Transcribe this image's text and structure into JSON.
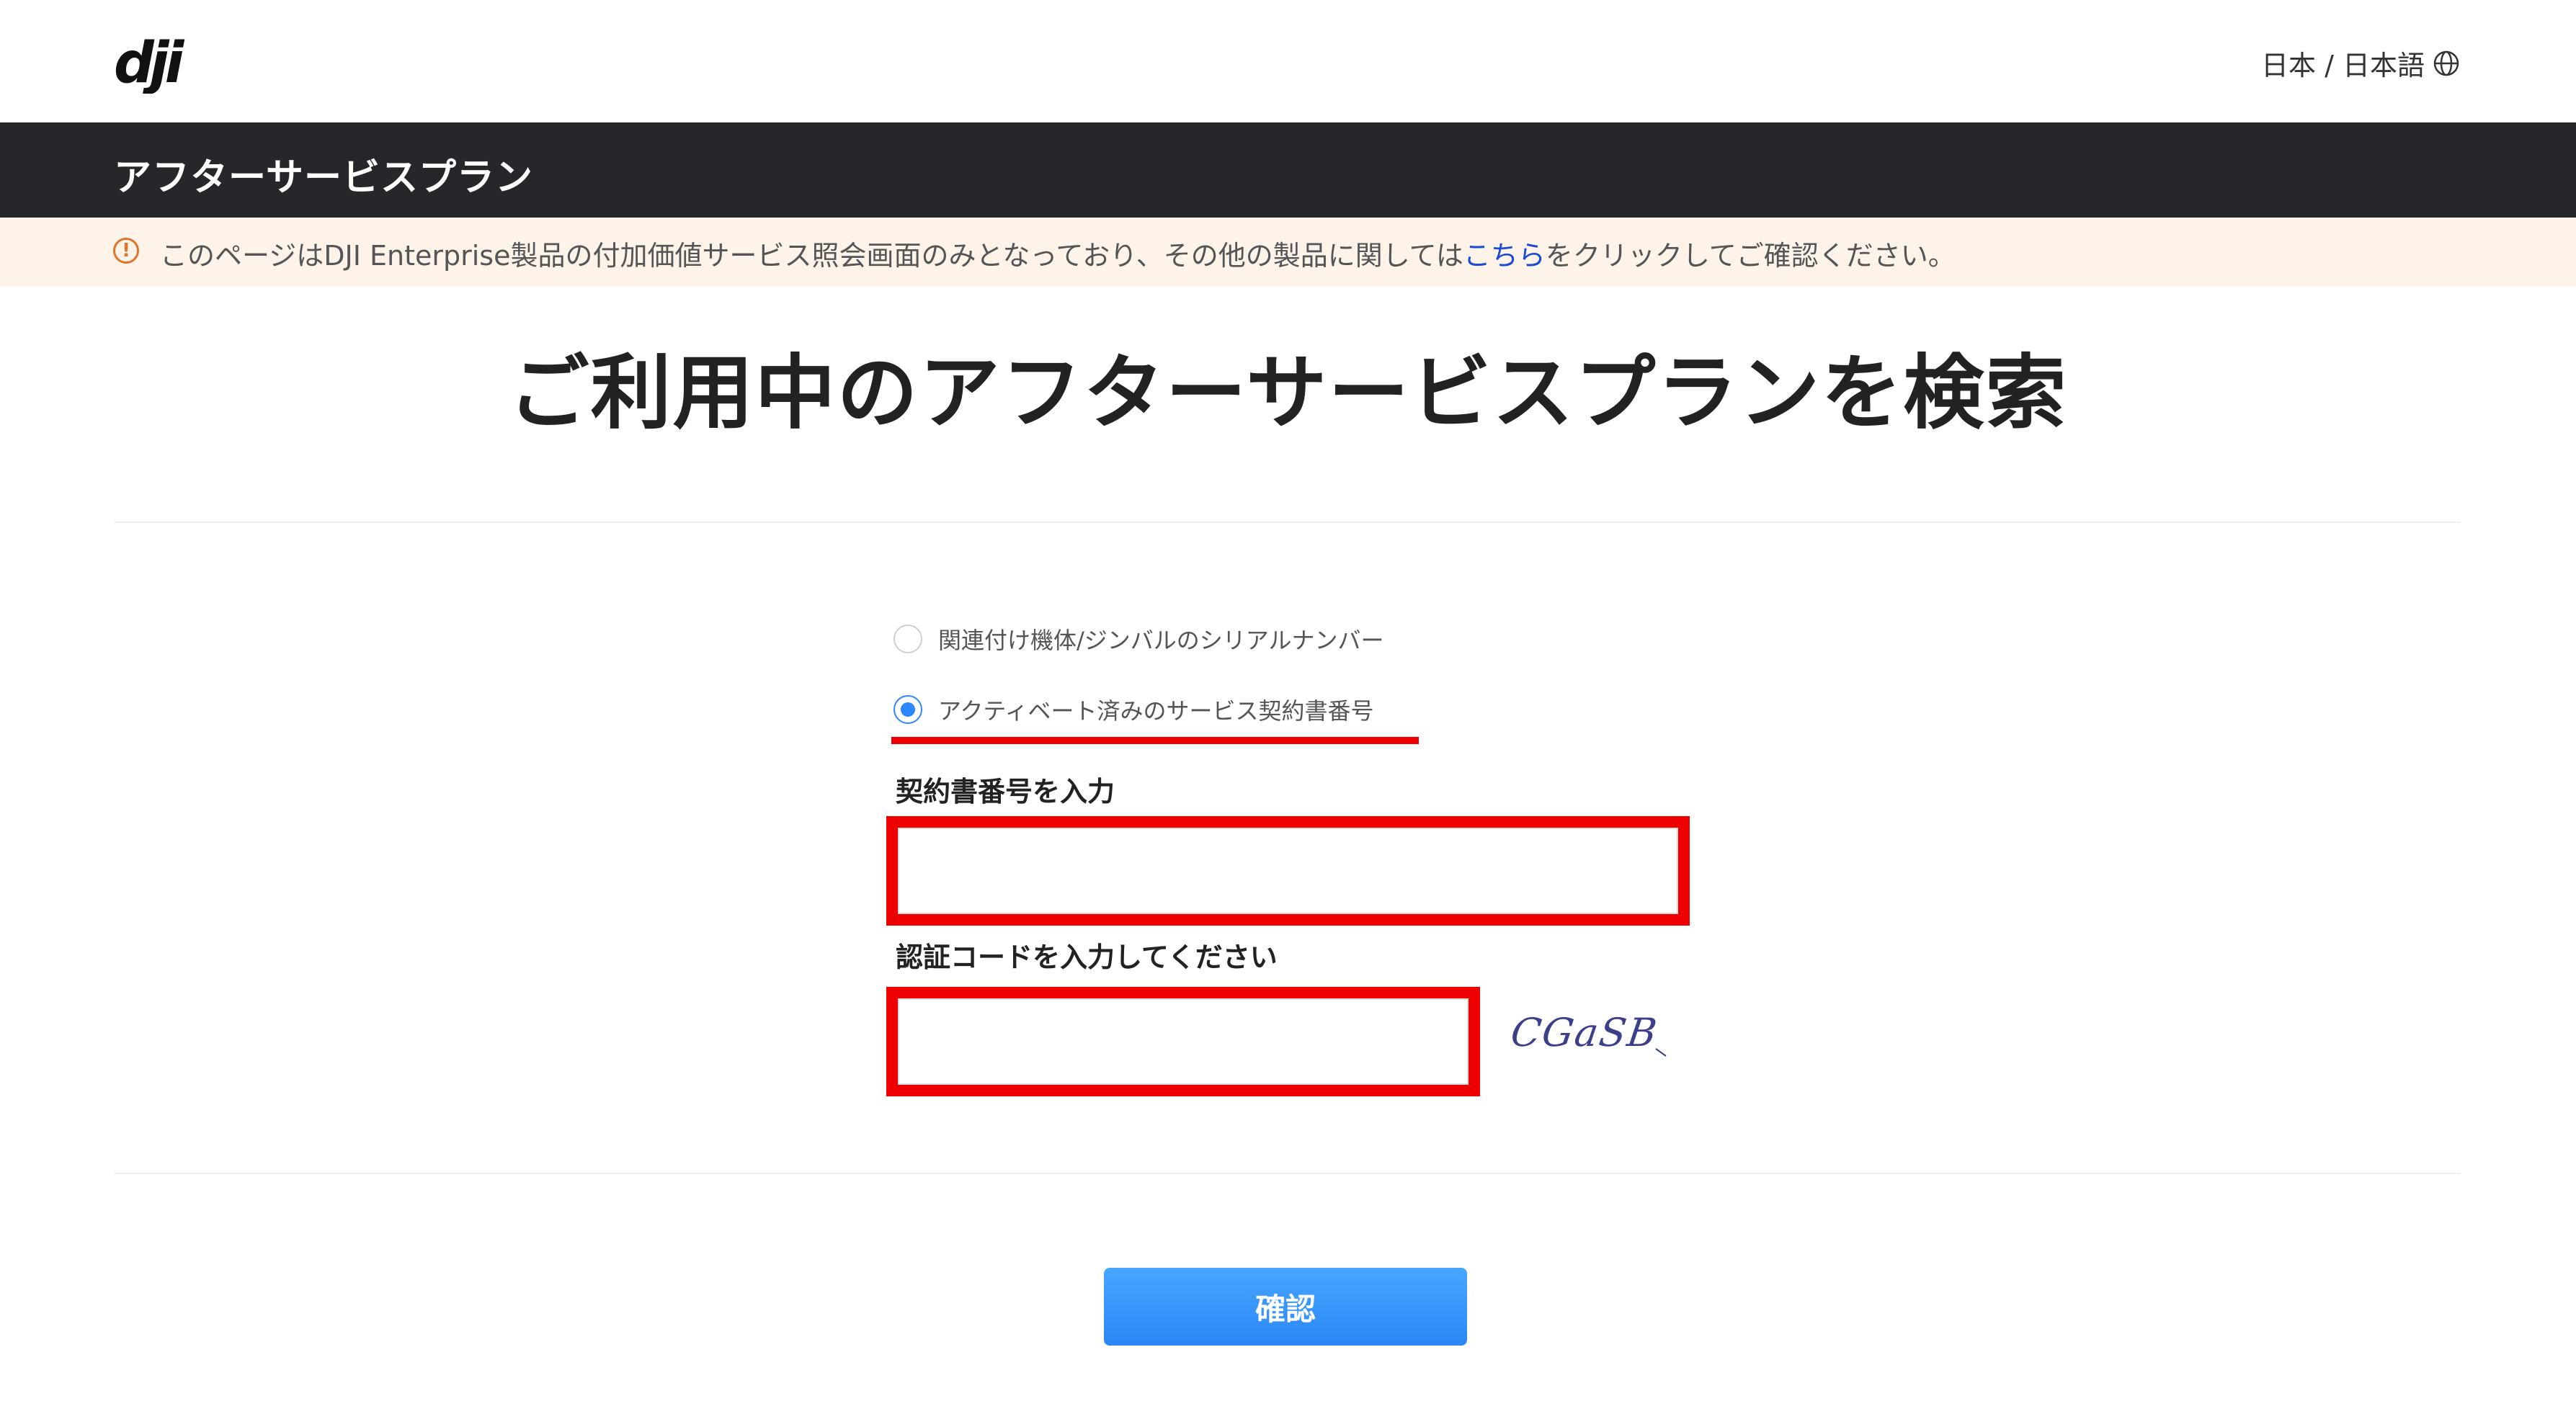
{
  "header": {
    "logo_text": "dji",
    "language": "日本 / 日本語",
    "icons": {
      "logo": "dji-logo",
      "language": "globe-icon"
    }
  },
  "banner": {
    "title": "アフターサービスプラン"
  },
  "notice": {
    "icon": "warning-icon",
    "text_before": "このページはDJI Enterprise製品の付加価値サービス照会画面のみとなっており、その他の製品に関しては",
    "link_text": "こちら",
    "text_after": "をクリックしてご確認ください。"
  },
  "page": {
    "heading": "ご利用中のアフターサービスプランを検索"
  },
  "form": {
    "options": [
      {
        "label": "関連付け機体/ジンバルのシリアルナンバー",
        "selected": false
      },
      {
        "label": "アクティベート済みのサービス契約書番号",
        "selected": true
      }
    ],
    "contract_label": "契約書番号を入力",
    "contract_value": "",
    "captcha_label": "認証コードを入力してください",
    "captcha_value": "",
    "captcha_image_text": "CGaSB",
    "submit_label": "確認"
  },
  "colors": {
    "header_bg": "#25272b",
    "notice_bg": "#fdf3e8",
    "warning": "#e0742b",
    "link": "#1b4bd6",
    "highlight": "#ee0000",
    "radio_active": "#2c86ff",
    "button": "#2a87f5"
  }
}
